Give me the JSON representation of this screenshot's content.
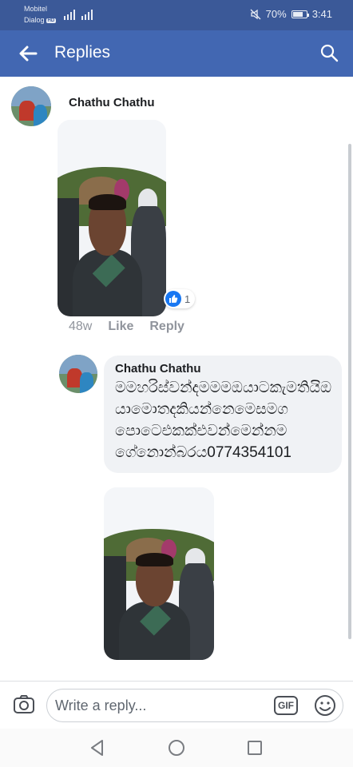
{
  "status_bar": {
    "carrier_1": "Mobitel",
    "carrier_2": "Dialog",
    "carrier_2_badge": "HD",
    "battery": "70%",
    "time": "3:41"
  },
  "app_bar": {
    "title": "Replies",
    "color": "#4267b2"
  },
  "comment": {
    "author": "Chathu Chathu",
    "reaction_count": "1",
    "time": "48w",
    "like_label": "Like",
    "reply_label": "Reply"
  },
  "reply": {
    "author": "Chathu Chathu",
    "text": "මමහරිස්වන්දමමමඔයාටකැමතියිඔයාමොතදකියන්නෙමෙසමගපොටෙඑකක්එවන්මෙන්නමගේනොන්බරය0774354101"
  },
  "composer": {
    "placeholder": "Write a reply...",
    "gif_label": "GIF"
  }
}
